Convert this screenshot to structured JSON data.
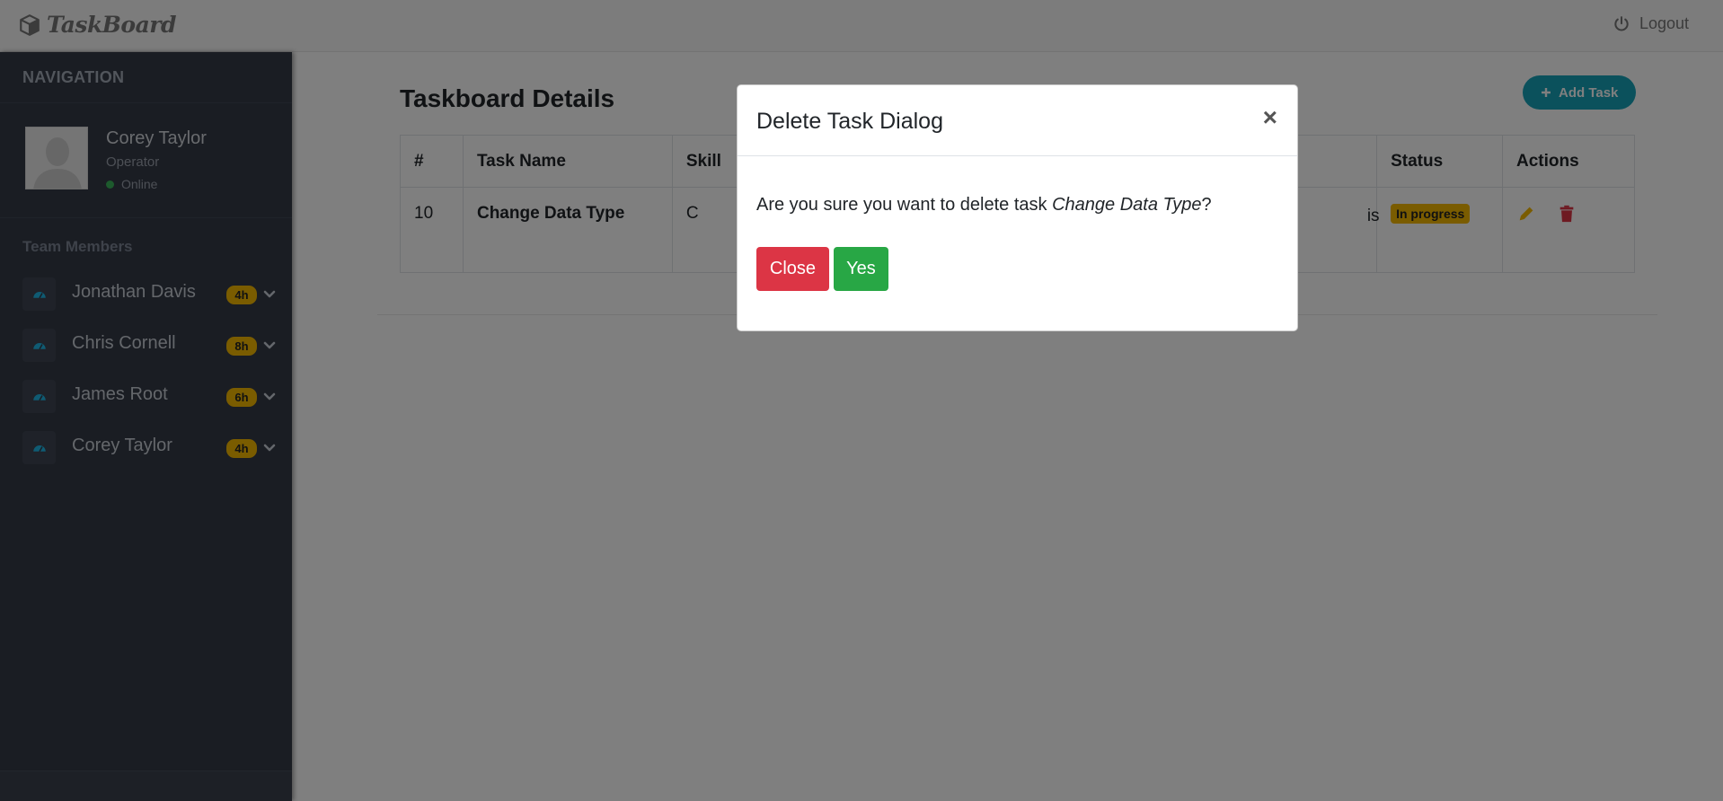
{
  "app": {
    "brand": "TaskBoard",
    "logout_label": "Logout"
  },
  "sidebar": {
    "nav_title": "NAVIGATION",
    "user": {
      "name": "Corey Taylor",
      "role": "Operator",
      "status": "Online"
    },
    "team_title": "Team Members",
    "members": [
      {
        "name": "Jonathan Davis",
        "hours": "4h"
      },
      {
        "name": "Chris Cornell",
        "hours": "8h"
      },
      {
        "name": "James Root",
        "hours": "6h"
      },
      {
        "name": "Corey Taylor",
        "hours": "4h"
      }
    ]
  },
  "main": {
    "title_prefix": "Taskboard",
    "title_bold": "Details",
    "add_task_label": "Add Task",
    "table": {
      "headers": {
        "num": "#",
        "task": "Task Name",
        "skill": "Skill",
        "status": "Status",
        "actions": "Actions"
      },
      "rows": [
        {
          "num": "10",
          "task": "Change Data Type",
          "skill": "C",
          "assignee_partial": "is",
          "status": "In progress"
        }
      ]
    }
  },
  "modal": {
    "title": "Delete Task Dialog",
    "close_symbol": "×",
    "message_prefix": "Are you sure you want to delete task ",
    "message_task": "Change Data Type",
    "message_suffix": "?",
    "close_label": "Close",
    "yes_label": "Yes"
  },
  "colors": {
    "sidebar_bg": "#343a47",
    "badge_yellow": "#f4b800",
    "btn_danger": "#dc3545",
    "btn_success": "#28a745",
    "btn_info": "#17a2b8"
  },
  "icons": {
    "brand": "cube-icon",
    "logout": "power-icon",
    "member": "dashboard-icon",
    "chevron": "chevron-down-icon",
    "edit": "pencil-icon",
    "delete": "trash-icon",
    "add": "plus-icon"
  }
}
